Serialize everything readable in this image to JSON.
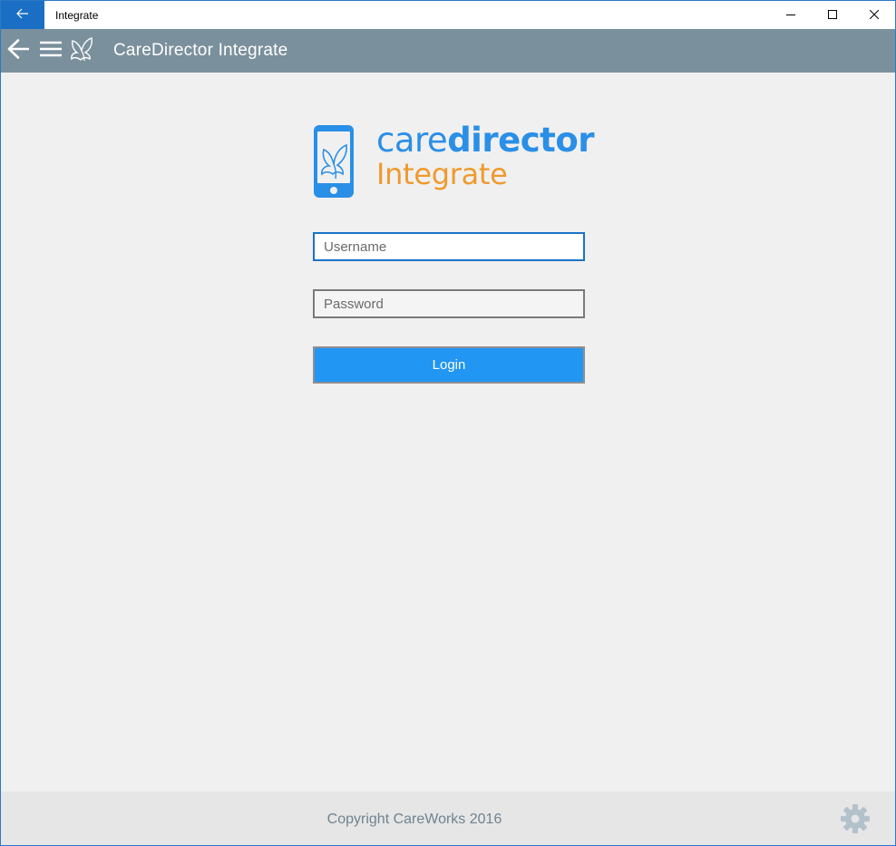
{
  "window": {
    "title": "Integrate",
    "back_icon": "arrow-left-icon",
    "controls": [
      "minimize-icon",
      "maximize-icon",
      "close-icon"
    ]
  },
  "appbar": {
    "title": "CareDirector Integrate",
    "icons": [
      "back-arrow-icon",
      "hamburger-menu-icon",
      "butterfly-logo-icon"
    ]
  },
  "logo": {
    "word_care": "care",
    "word_director": "director",
    "word_integrate": "Integrate",
    "colors": {
      "blue": "#2a8fe6",
      "orange": "#ef9a2e"
    }
  },
  "login": {
    "username_placeholder": "Username",
    "password_placeholder": "Password",
    "button_label": "Login"
  },
  "footer": {
    "copyright": "Copyright CareWorks 2016",
    "settings_icon": "gear-icon"
  },
  "colors": {
    "accent": "#2196f3",
    "titlebar_accent": "#1a6fc4",
    "header": "#7a909c",
    "background": "#f0f0f0"
  }
}
